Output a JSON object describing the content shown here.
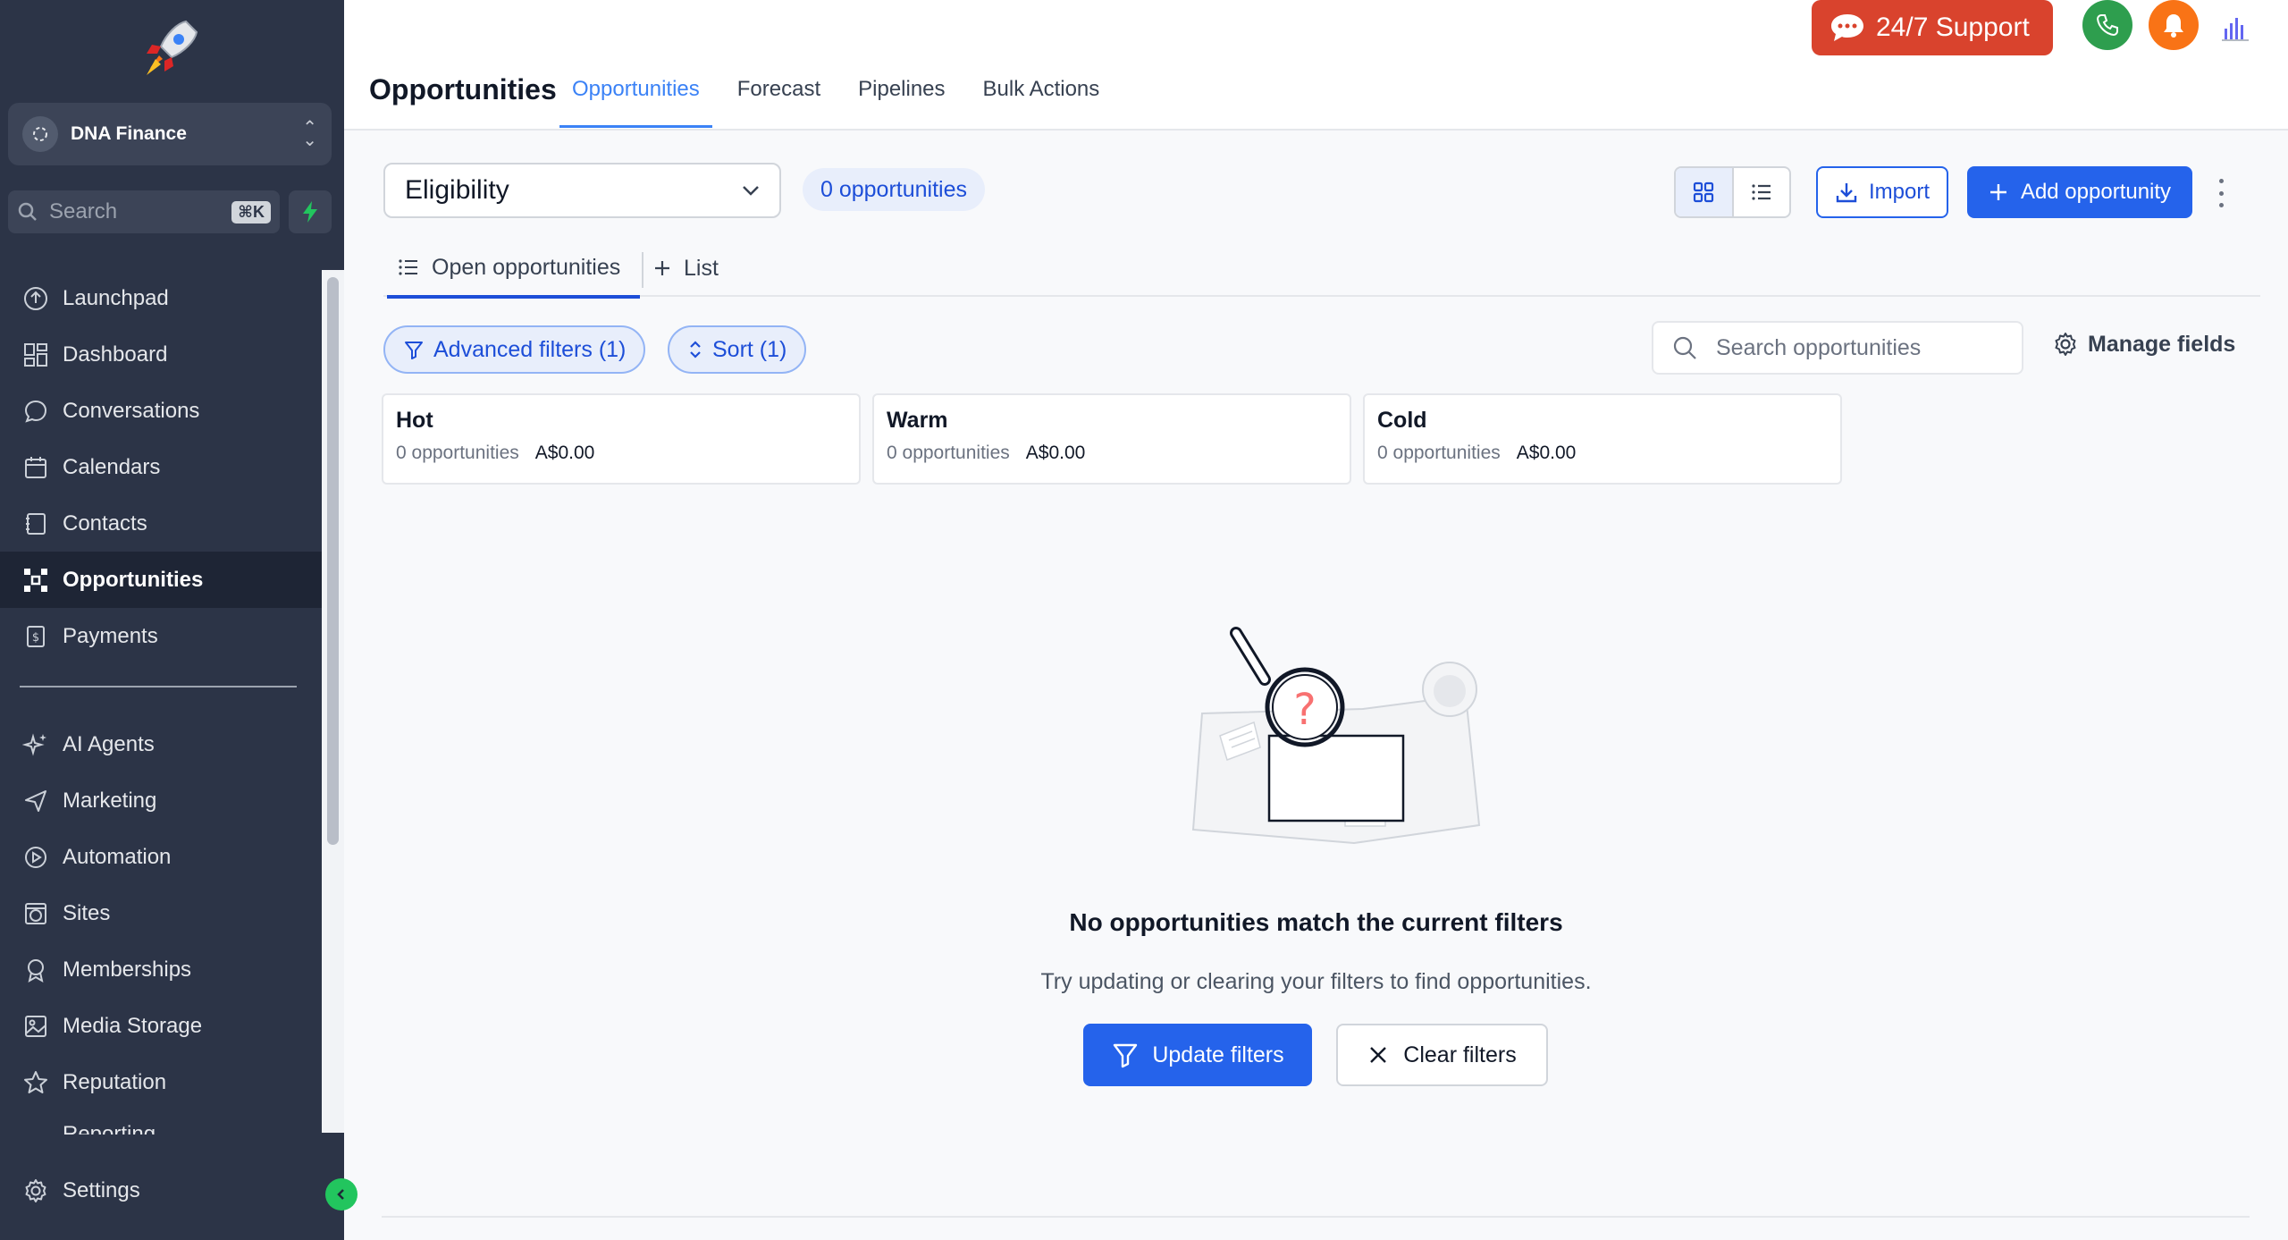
{
  "sidebar": {
    "account_name": "DNA Finance",
    "search_placeholder": "Search",
    "search_shortcut": "⌘K",
    "items": [
      {
        "label": "Launchpad",
        "icon": "launchpad-icon"
      },
      {
        "label": "Dashboard",
        "icon": "dashboard-icon"
      },
      {
        "label": "Conversations",
        "icon": "chat-icon"
      },
      {
        "label": "Calendars",
        "icon": "calendar-icon"
      },
      {
        "label": "Contacts",
        "icon": "contacts-icon"
      },
      {
        "label": "Opportunities",
        "icon": "opportunities-icon",
        "active": true
      },
      {
        "label": "Payments",
        "icon": "payments-icon"
      }
    ],
    "items2": [
      {
        "label": "AI Agents",
        "icon": "sparkle-icon"
      },
      {
        "label": "Marketing",
        "icon": "send-icon"
      },
      {
        "label": "Automation",
        "icon": "automation-icon"
      },
      {
        "label": "Sites",
        "icon": "globe-icon"
      },
      {
        "label": "Memberships",
        "icon": "award-icon"
      },
      {
        "label": "Media Storage",
        "icon": "image-icon"
      },
      {
        "label": "Reputation",
        "icon": "star-icon"
      }
    ],
    "cut_item": "Reporting",
    "settings_label": "Settings"
  },
  "header": {
    "title": "Opportunities",
    "tabs": [
      "Opportunities",
      "Forecast",
      "Pipelines",
      "Bulk Actions"
    ],
    "support_label": "24/7 Support"
  },
  "toolbar": {
    "pipeline_selected": "Eligibility",
    "count_badge": "0 opportunities",
    "import_label": "Import",
    "add_label": "Add opportunity"
  },
  "subtabs": {
    "open": "Open opportunities",
    "list": "List"
  },
  "filters": {
    "advanced": "Advanced filters (1)",
    "sort": "Sort (1)",
    "search_placeholder": "Search opportunities",
    "manage_fields": "Manage fields"
  },
  "stages": [
    {
      "name": "Hot",
      "count": "0 opportunities",
      "amount": "A$0.00"
    },
    {
      "name": "Warm",
      "count": "0 opportunities",
      "amount": "A$0.00"
    },
    {
      "name": "Cold",
      "count": "0 opportunities",
      "amount": "A$0.00"
    }
  ],
  "empty_state": {
    "title": "No opportunities match the current filters",
    "subtitle": "Try updating or clearing your filters to find opportunities.",
    "update_label": "Update filters",
    "clear_label": "Clear filters"
  },
  "colors": {
    "sidebar_bg": "#2c3447",
    "primary": "#2563eb",
    "support": "#d9432d",
    "phone": "#2e9e4e",
    "bell": "#f97316"
  }
}
